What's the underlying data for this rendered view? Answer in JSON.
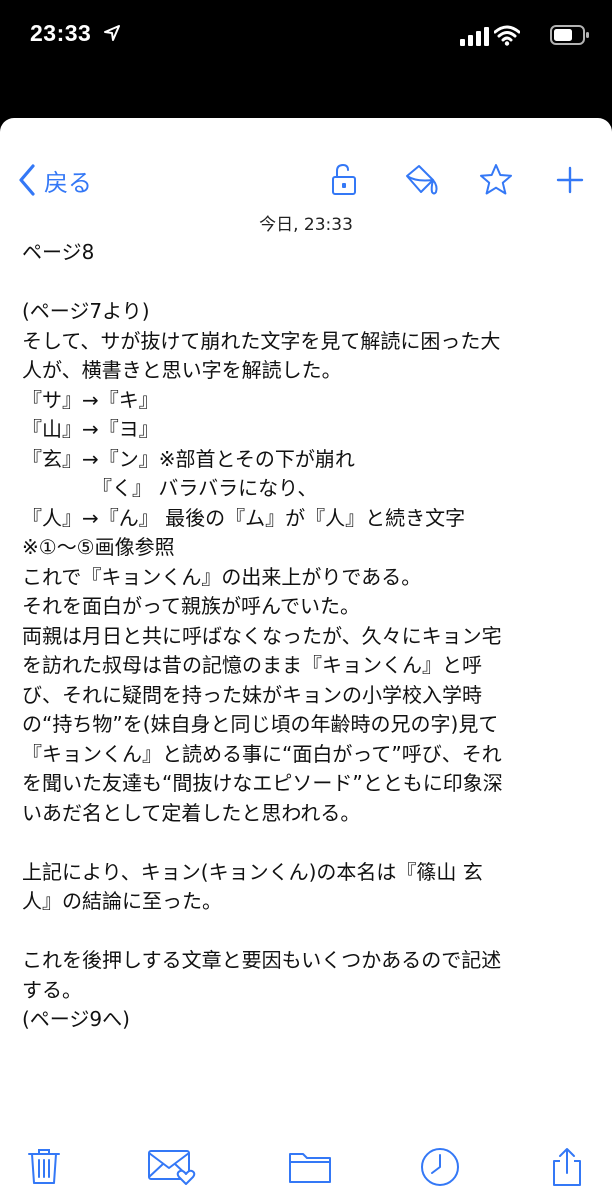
{
  "status": {
    "time": "23:33"
  },
  "nav": {
    "back_label": "戻る"
  },
  "message": {
    "date": "今日, 23:33",
    "lines": [
      "ページ8",
      "",
      "(ページ7より)",
      "そして、サが抜けて崩れた文字を見て解読に困った大",
      "人が、横書きと思い字を解読した。",
      "『サ』→『キ』",
      "『山』→『ヨ』",
      "『玄』→『ン』※部首とその下が崩れ",
      "　　　　『く』 バラバラになり、",
      "『人』→『ん』 最後の『ム』が『人』と続き文字",
      "※①〜⑤画像参照",
      "これで『キョンくん』の出来上がりである。",
      "それを面白がって親族が呼んでいた。",
      "両親は月日と共に呼ばなくなったが、久々にキョン宅",
      "を訪れた叔母は昔の記憶のまま『キョンくん』と呼",
      "び、それに疑問を持った妹がキョンの小学校入学時",
      "の“持ち物”を(妹自身と同じ頃の年齢時の兄の字)見て",
      "『キョンくん』と読める事に“面白がって”呼び、それ",
      "を聞いた友達も“間抜けなエピソード”とともに印象深",
      "いあだ名として定着したと思われる。",
      "",
      "上記により、キョン(キョンくん)の本名は『篠山 玄",
      "人』の結論に至った。",
      "",
      "これを後押しする文章と要因もいくつかあるので記述",
      "する。",
      "(ページ9へ)"
    ]
  },
  "colors": {
    "accent": "#3478f6",
    "background": "#ffffff",
    "status_bar": "#000000"
  }
}
